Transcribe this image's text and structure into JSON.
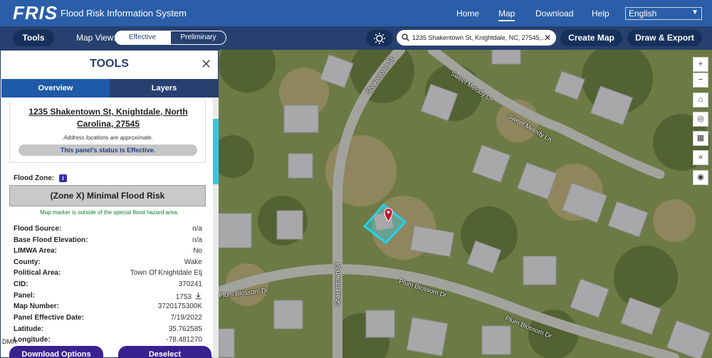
{
  "header": {
    "logo": "FRIS",
    "app_title": "Flood Risk Information System",
    "nav": [
      "Home",
      "Map",
      "Download",
      "Help"
    ],
    "active_nav": "Map",
    "language": "English"
  },
  "toolbar": {
    "tools_label": "Tools",
    "map_view_label": "Map View:",
    "view_effective": "Effective",
    "view_preliminary": "Preliminary",
    "search_value": "1235 Shakentown St, Knightdale, NC, 27545,...",
    "create_map_label": "Create Map",
    "draw_export_label": "Draw & Export"
  },
  "map": {
    "streets": [
      "Shakentown St",
      "Sweet Melody Ln",
      "Sweet Melody Ln",
      "Plum Blossom Dr",
      "Plum Blossom Dr",
      "Plum Blossom Dr",
      "Shakentown St"
    ],
    "controls": [
      "+",
      "−",
      "home-icon",
      "locate-icon",
      "qr-icon",
      "collapse-icon",
      "globe-icon"
    ],
    "highlight_color": "#22d3ee",
    "marker_color": "#c8102e"
  },
  "panel": {
    "title": "TOOLS",
    "tab_overview": "Overview",
    "tab_layers": "Layers",
    "address": "1235 Shakentown St, Knightdale, North Carolina, 27545",
    "address_line1": "1235 Shakentown St, Knightdale, North",
    "address_line2": "Carolina, 27545",
    "address_note": "Address locations are approximate.",
    "status": "This panel's status is Effective.",
    "flood_zone_label": "Flood Zone:",
    "flood_zone_value": "(Zone X) Minimal Flood Risk",
    "flood_zone_note": "Map marker is outside of the special flood hazard area.",
    "rows": [
      {
        "key": "Flood Source:",
        "value": "n/a"
      },
      {
        "key": "Base Flood Elevation:",
        "value": "n/a"
      },
      {
        "key": "LIMWA Area:",
        "value": "No"
      },
      {
        "key": "County:",
        "value": "Wake"
      },
      {
        "key": "Political Area:",
        "value": "Town Of Knightdale Etj"
      },
      {
        "key": "CID:",
        "value": "370241"
      },
      {
        "key": "Panel:",
        "value": "1753"
      },
      {
        "key": "Map Number:",
        "value": "3720175300K"
      },
      {
        "key": "Panel Effective Date:",
        "value": "7/19/2022"
      },
      {
        "key": "Latitude:",
        "value": "35.762585"
      },
      {
        "key": "Longitude:",
        "value": "-78.481270"
      }
    ],
    "watermark": "DMR",
    "download_label": "Download Options",
    "deselect_label": "Deselect"
  }
}
